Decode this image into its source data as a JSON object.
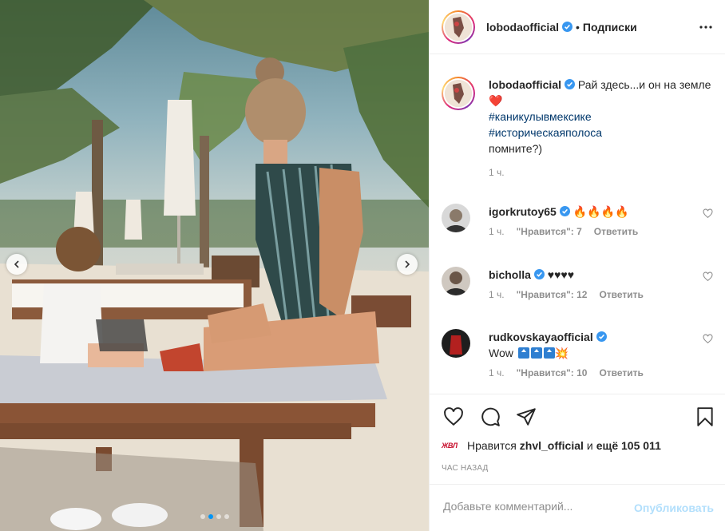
{
  "post": {
    "author": "lobodaofficial",
    "separator": "•",
    "follow_label": "Подписки",
    "caption_text": "Рай здесь...и он на земле",
    "caption_heart": "❤️",
    "hashtags": [
      "#каникулывмексике",
      "#историческаяполоса"
    ],
    "caption_tail": "помните?)",
    "caption_time": "1 ч."
  },
  "comments": [
    {
      "username": "igorkrutoy65",
      "text": "🔥🔥🔥🔥",
      "time": "1 ч.",
      "likes": "\"Нравится\": 7",
      "reply": "Ответить"
    },
    {
      "username": "bicholla",
      "text": "♥♥♥♥",
      "time": "1 ч.",
      "likes": "\"Нравится\": 12",
      "reply": "Ответить"
    },
    {
      "username": "rudkovskayaofficial",
      "text": "Wow",
      "time": "1 ч.",
      "likes": "\"Нравится\": 10",
      "reply": "Ответить"
    }
  ],
  "likes_line": {
    "avatar_text": "ЖВЛ",
    "prefix": "Нравится",
    "user": "zhvl_official",
    "middle": "и",
    "rest": "ещё 105 011"
  },
  "time_ago": "ЧАС НАЗАД",
  "comment_input": {
    "placeholder": "Добавьте комментарий...",
    "value": ""
  },
  "publish_label": "Опубликовать",
  "carousel": {
    "count": 4,
    "active": 1
  },
  "colors": {
    "link": "#00376b",
    "accent": "#0095f6",
    "muted": "#8e8e8e",
    "publish_disabled": "#b2dffc",
    "verified": "#3897f0"
  }
}
